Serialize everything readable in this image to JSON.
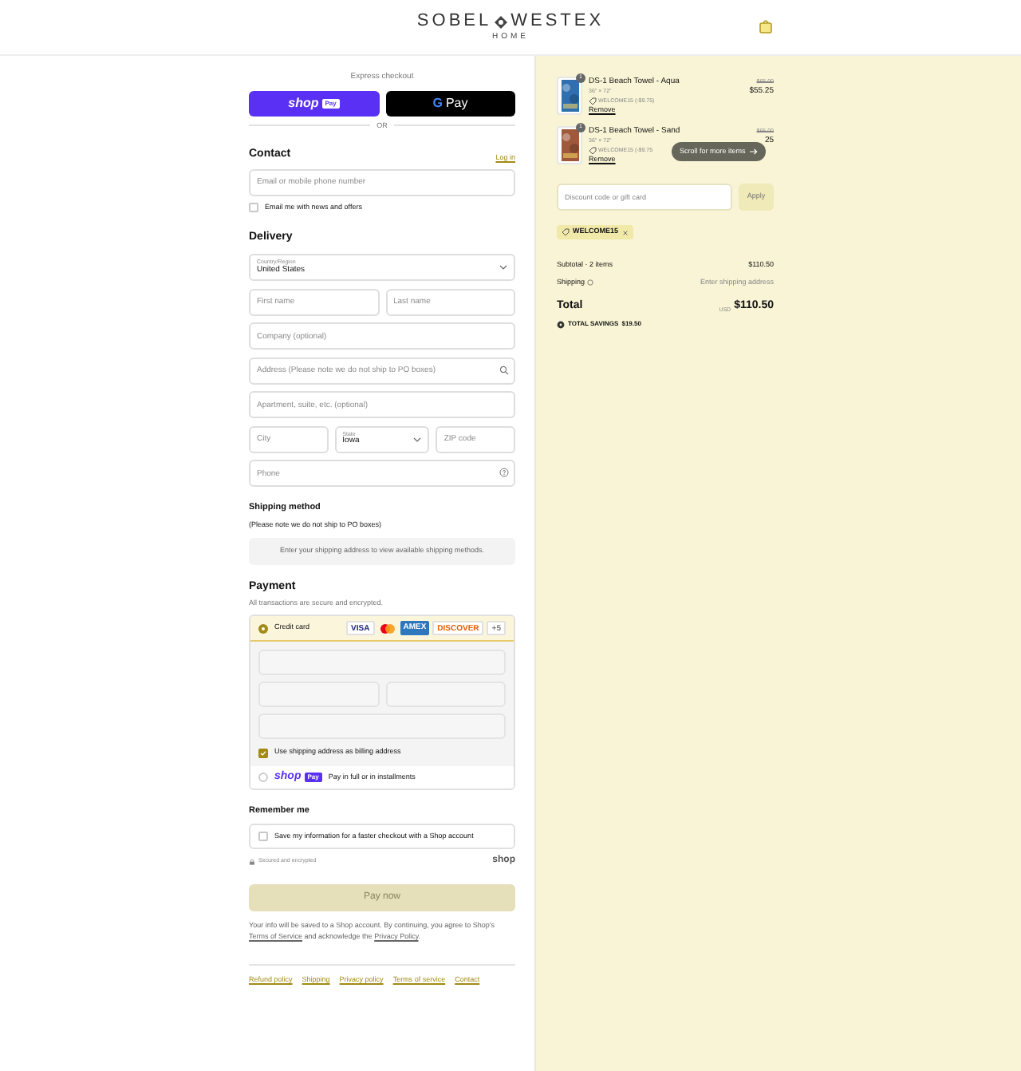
{
  "header": {
    "brand_left": "SOBEL",
    "brand_right": "WESTEX",
    "brand_sub": "HOME"
  },
  "express": {
    "label": "Express checkout",
    "shop": {
      "logo": "shop",
      "badge": "Pay"
    },
    "gpay": {
      "logo": "G",
      "text": "Pay"
    },
    "or_text": "OR"
  },
  "contact": {
    "title": "Contact",
    "link": "Log in",
    "field": {
      "placeholder": "Email or mobile phone number"
    },
    "news": {
      "label": "Email me with news and offers",
      "checked": false
    }
  },
  "delivery": {
    "title": "Delivery",
    "rows": [
      [
        {
          "kind": "select",
          "label": "Country/Region",
          "value": "United States"
        }
      ],
      [
        {
          "kind": "input",
          "placeholder": "First name"
        },
        {
          "kind": "input",
          "placeholder": "Last name"
        }
      ],
      [
        {
          "kind": "input",
          "placeholder": "Company (optional)"
        }
      ],
      [
        {
          "kind": "search",
          "placeholder": "Address (Please note we do not ship to PO boxes)"
        }
      ],
      [
        {
          "kind": "input",
          "placeholder": "Apartment, suite, etc. (optional)"
        }
      ],
      [
        {
          "kind": "input",
          "placeholder": "City"
        },
        {
          "kind": "select",
          "label": "State",
          "value": "Iowa"
        },
        {
          "kind": "input",
          "placeholder": "ZIP code"
        }
      ],
      [
        {
          "kind": "help",
          "placeholder": "Phone"
        }
      ]
    ]
  },
  "shipping": {
    "title": "Shipping method",
    "note": "(Please note we do not ship to PO boxes)",
    "message": "Enter your shipping address to view available shipping methods."
  },
  "payment": {
    "title": "Payment",
    "subtitle": "All transactions are secure and encrypted.",
    "methods": [
      {
        "kind": "card",
        "label": "Credit card",
        "selected": true,
        "cards": [
          {
            "kind": "visa",
            "text": "VISA"
          },
          {
            "kind": "mastercard"
          },
          {
            "kind": "amex",
            "text": "AMEX"
          },
          {
            "kind": "discover",
            "text": "DISCOVER"
          },
          {
            "kind": "more",
            "text": "+5"
          }
        ],
        "billing": {
          "label": "Use shipping address as billing address",
          "checked": true
        }
      },
      {
        "kind": "shoppay",
        "logo": "shop",
        "badge": "Pay",
        "label": "Pay in full or in installments",
        "selected": false
      }
    ]
  },
  "remember": {
    "title": "Remember me",
    "save": {
      "label": "Save my information for a faster checkout with a Shop account",
      "checked": false
    },
    "secure": "Secured and encrypted",
    "shop_logo": "shop"
  },
  "pay_button": "Pay now",
  "disclaimer": {
    "text": "Your info will be saved to a Shop account. By continuing, you agree to Shop's",
    "link1": "Terms of Service",
    "middle": "and acknowledge the",
    "link2": "Privacy Policy",
    "end": "."
  },
  "footer_links": [
    "Refund policy",
    "Shipping",
    "Privacy policy",
    "Terms of service",
    "Contact"
  ],
  "summary": {
    "items": [
      {
        "quantity": "1",
        "name": "DS-1 Beach Towel - Aqua",
        "variant": "36\" × 72\"",
        "discount": "WELCOME15 (-$9.75)",
        "price_original": "$65.00",
        "price": "$55.25",
        "remove": "Remove"
      },
      {
        "quantity": "1",
        "name": "DS-1 Beach Towel - Sand",
        "variant": "36\" × 72\"",
        "discount": "WELCOME15 (-$9.75",
        "price_original": "$65.00",
        "price": "25",
        "remove": "Remove"
      }
    ],
    "scroll_hint": "Scroll for more items",
    "discount_field": {
      "placeholder": "Discount code or gift card"
    },
    "apply": "Apply",
    "code": "WELCOME15",
    "subtotal": {
      "label": "Subtotal · 2 items",
      "value": "$110.50"
    },
    "shipping": {
      "label": "Shipping",
      "value": "Enter shipping address"
    },
    "total": {
      "label": "Total",
      "currency": "USD",
      "value": "$110.50"
    },
    "savings": {
      "label": "TOTAL SAVINGS",
      "value": "$19.50"
    }
  }
}
